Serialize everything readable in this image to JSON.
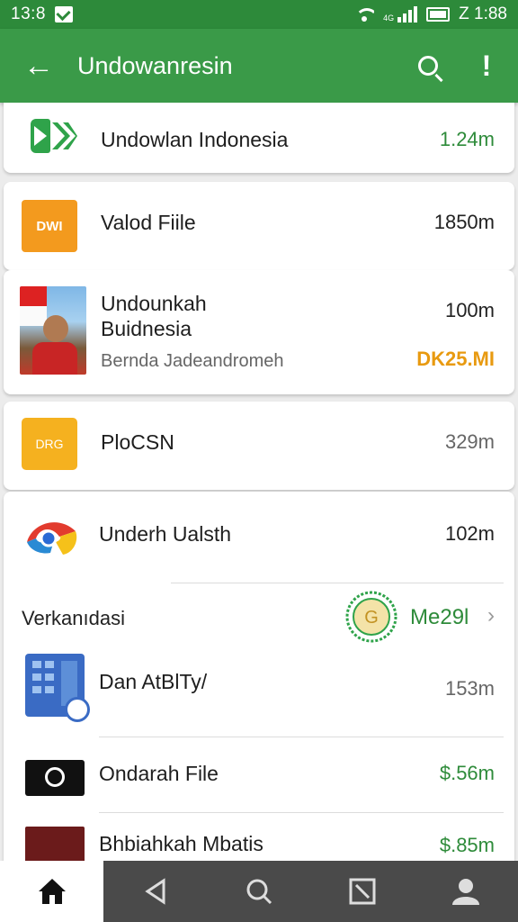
{
  "status": {
    "time": "13:8",
    "right_text": "Z 1:88",
    "signal_label": "4G"
  },
  "app_bar": {
    "title": "Undowanresin"
  },
  "items": [
    {
      "name": "Undowlan Indonesia",
      "size": "1.24m",
      "size_color": "#2e8b3a"
    },
    {
      "name": "Valod Fiile",
      "size": "1850m",
      "icon_text": "DWI"
    },
    {
      "name_line1": "Undounkah",
      "name_line2": "Buidnesia",
      "size": "100m",
      "subtitle": "Bernda Jadeandromeh",
      "subsize": "DK25.MI"
    },
    {
      "name": "PloCSN",
      "size": "329m",
      "icon_text": "DRG"
    },
    {
      "name": "Underh Ualsth",
      "size": "102m"
    }
  ],
  "section": {
    "title": "Verkanıdasi",
    "link": "Me29l"
  },
  "list": [
    {
      "name": "Dan AtBlTy/",
      "size": "153m"
    },
    {
      "name": "Ondarah File",
      "size": "$.56m"
    },
    {
      "name": "Bhbiahkah Mbatis",
      "size": "$.85m"
    }
  ],
  "nav": [
    "home-icon",
    "back-icon",
    "search-icon",
    "box-icon",
    "profile-icon"
  ]
}
